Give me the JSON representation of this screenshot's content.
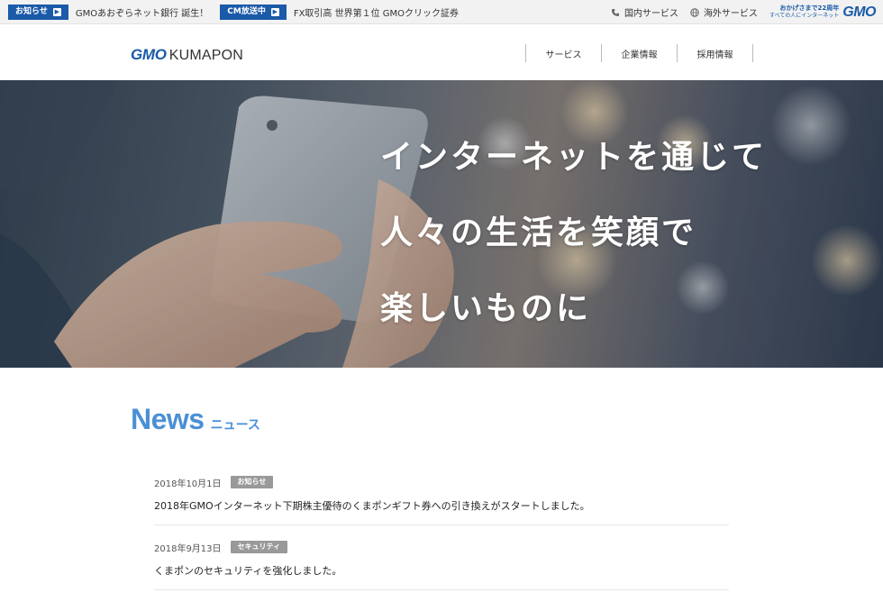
{
  "topbar": {
    "news_badge": "お知らせ",
    "news_text": "GMOあおぞらネット銀行 誕生！",
    "cm_badge": "CM放送中",
    "cm_text": "FX取引高 世界第１位 GMOクリック証券",
    "domestic_label": "国内サービス",
    "overseas_label": "海外サービス",
    "gmo_tag_line1": "おかげさまで22周年",
    "gmo_tag_line2": "すべての人にインターネット",
    "gmo_logo": "GMO"
  },
  "header": {
    "logo_gmo": "GMO",
    "logo_name": "KUMAPON",
    "nav": [
      "サービス",
      "企業情報",
      "採用情報"
    ]
  },
  "hero": {
    "lines": [
      "インターネットを通じて",
      "人々の生活を笑顔で",
      "楽しいものに"
    ]
  },
  "news": {
    "title_en": "News",
    "title_ja": "ニュース",
    "items": [
      {
        "date": "2018年10月1日",
        "tag": "お知らせ",
        "text": "2018年GMOインターネット下期株主優待のくまポンギフト券への引き換えがスタートしました。"
      },
      {
        "date": "2018年9月13日",
        "tag": "セキュリティ",
        "text": "くまポンのセキュリティを強化しました。"
      }
    ]
  },
  "colors": {
    "brand": "#1a5aa8",
    "news_accent": "#4a8fd6",
    "tag_bg": "#999999"
  }
}
